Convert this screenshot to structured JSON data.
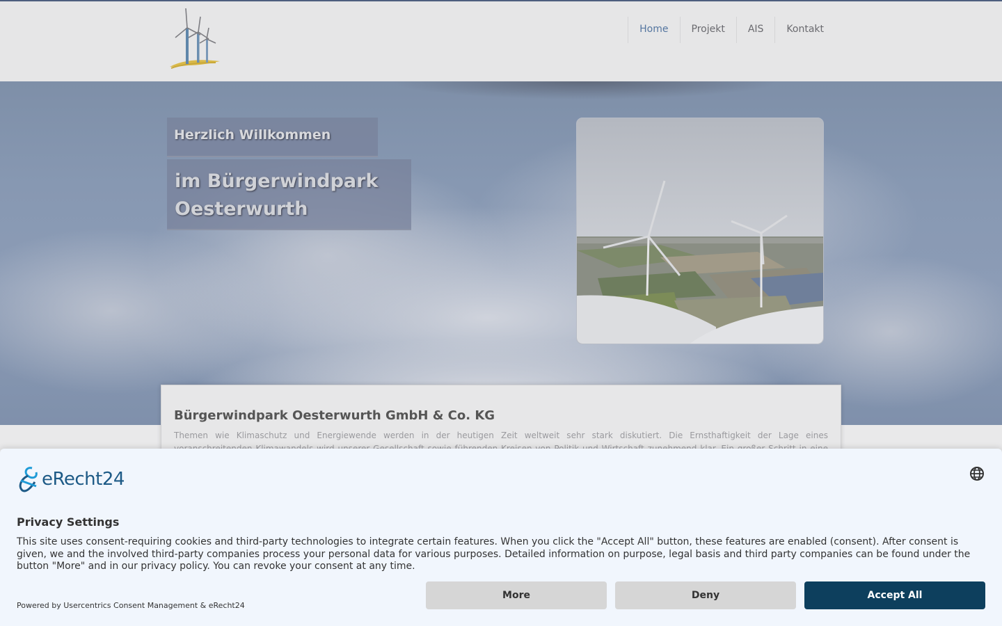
{
  "nav": {
    "items": [
      {
        "label": "Home",
        "active": true
      },
      {
        "label": "Projekt",
        "active": false
      },
      {
        "label": "AIS",
        "active": false
      },
      {
        "label": "Kontakt",
        "active": false
      }
    ],
    "active_color": "#5576a0"
  },
  "hero": {
    "welcome_line1": "Herzlich Willkommen",
    "welcome_line2": "im Bürgerwindpark Oesterwurth"
  },
  "content": {
    "title": "Bürgerwindpark Oesterwurth GmbH & Co. KG",
    "text": "Themen wie Klimaschutz und Energiewende werden in der heutigen Zeit weltweit sehr stark diskutiert. Die Ernsthaftigkeit der Lage eines voranschreitenden Klimawandels wird unserer Gesellschaft sowie führenden Kreisen von Politik und Wirtschaft zunehmend klar. Ein großer Schritt in eine umweltbewusste Zukunft"
  },
  "consent": {
    "brand": "eRecht24",
    "brand_color": "#1d5a86",
    "language_icon": "globe-icon",
    "title": "Privacy Settings",
    "text": "This site uses consent-requiring cookies and third-party technologies to integrate certain features. When you click the \"Accept All\" button, these features are enabled (consent). After consent is given, we and the involved third-party companies process your personal data for various purposes. Detailed information on purpose, legal basis and third party companies can be found under the button \"More\" and in our privacy policy. You can revoke your consent at any time.",
    "powered_by": "Powered by Usercentrics Consent Management & eRecht24",
    "buttons": {
      "more": "More",
      "deny": "Deny",
      "accept": "Accept All"
    },
    "accept_color": "#0d3f5d"
  }
}
